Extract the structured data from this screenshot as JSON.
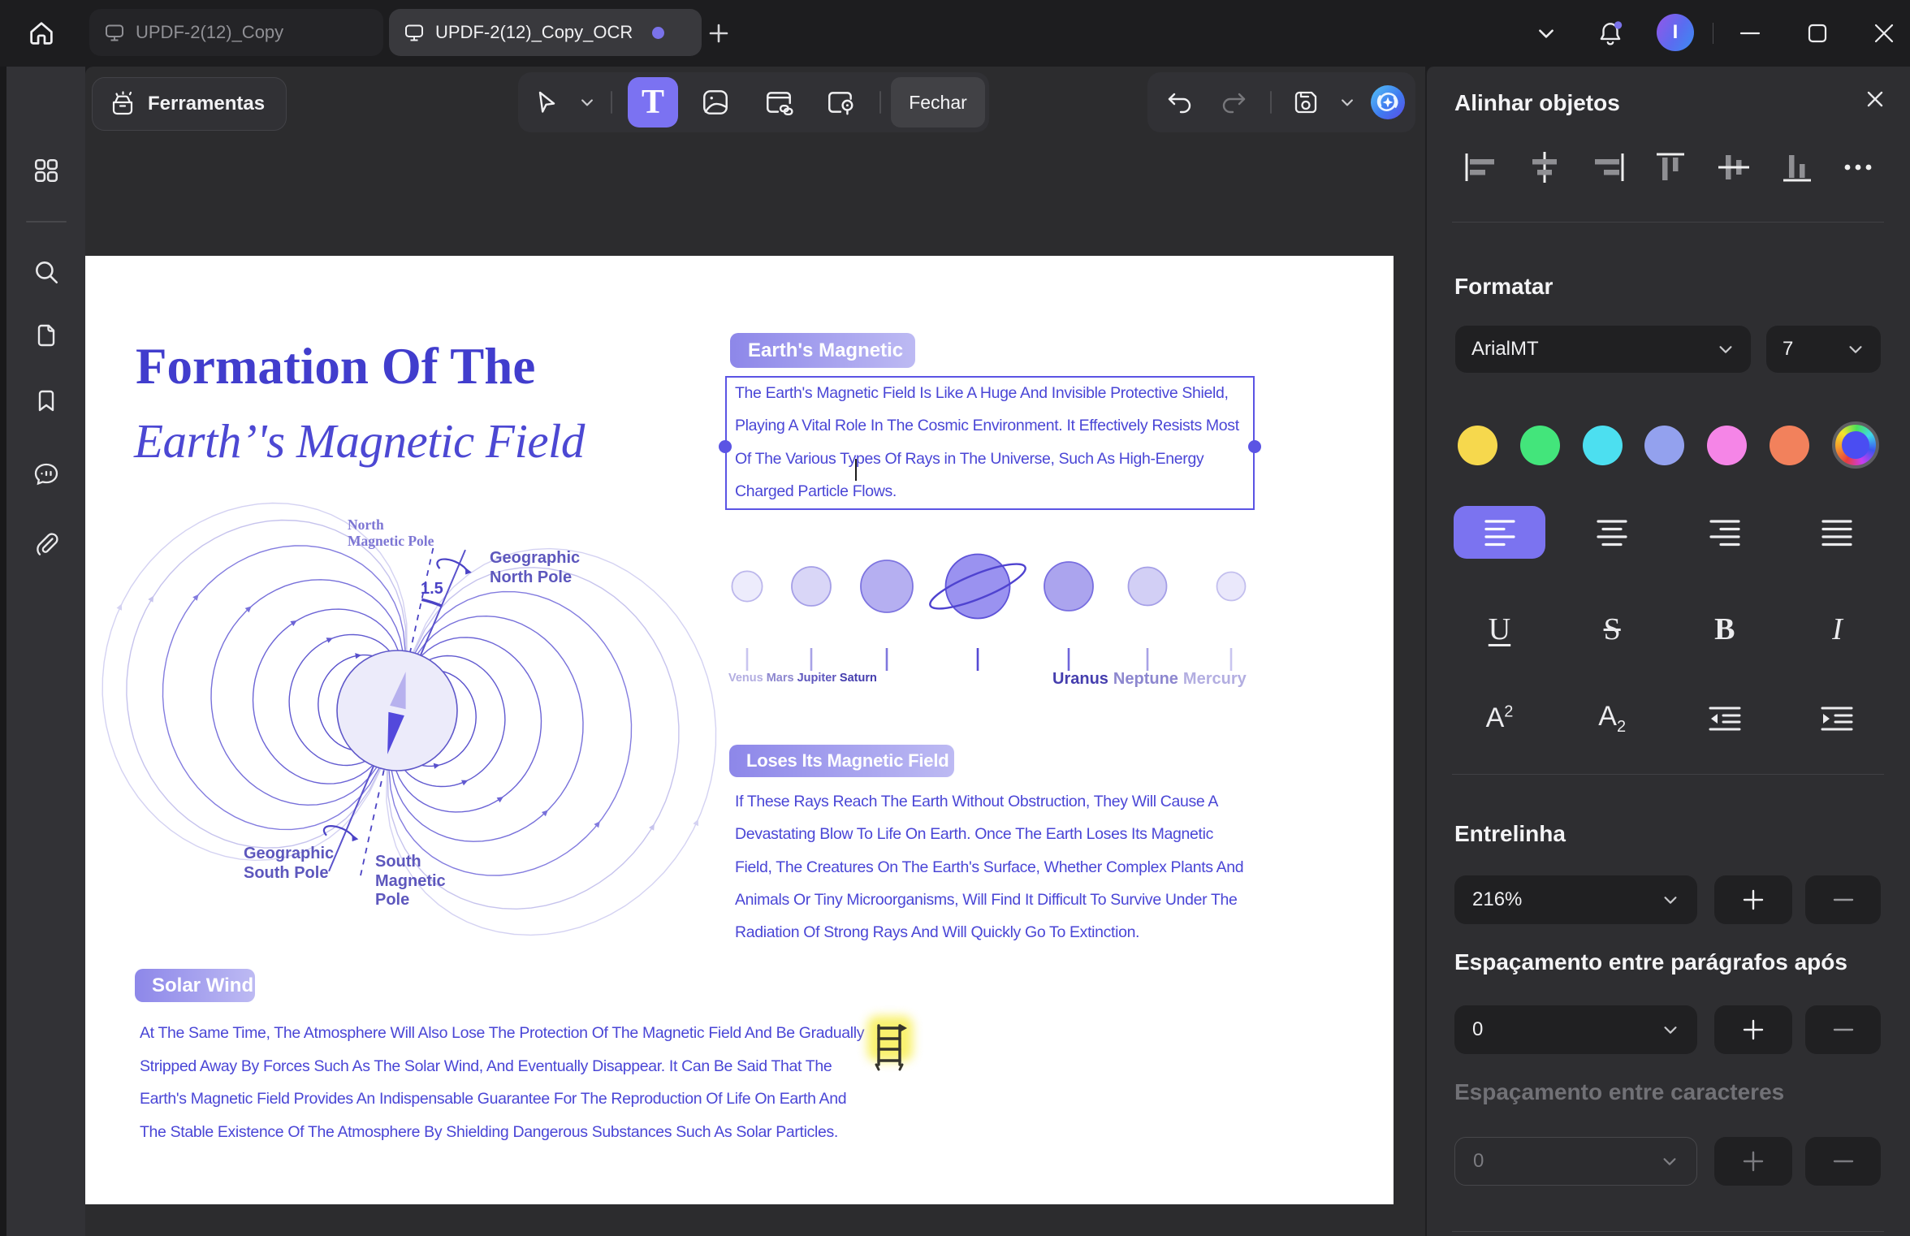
{
  "window": {
    "tabs": [
      {
        "label": "UPDF-2(12)_Copy",
        "active": false
      },
      {
        "label": "UPDF-2(12)_Copy_OCR",
        "active": true
      }
    ],
    "avatar_initial": "I"
  },
  "toolbar": {
    "tools_label": "Ferramentas",
    "close_label": "Fechar",
    "text_tool_glyph": "T"
  },
  "panel": {
    "title": "Alinhar objetos",
    "format_heading": "Formatar",
    "font_name": "ArialMT",
    "font_size": "7",
    "line_spacing_heading": "Entrelinha",
    "line_spacing_value": "216%",
    "para_spacing_heading": "Espaçamento entre parágrafos após",
    "para_spacing_value": "0",
    "char_spacing_heading": "Espaçamento entre caracteres",
    "char_spacing_value": "0",
    "style_glyphs": {
      "underline": "U",
      "strikethrough": "S",
      "bold": "B",
      "italic": "I"
    },
    "superscript_label": "A2",
    "subscript_label": "A2",
    "accent_color": "#7b73f0",
    "swatches": [
      "#f6d84d",
      "#43e57b",
      "#4cdff0",
      "#93a1ee",
      "#f585e7",
      "#f2815c"
    ]
  },
  "document": {
    "title_line1": "Formation Of The",
    "title_line2": "Earth’'s Magnetic Field",
    "chip1": "Earth's Magnetic",
    "textbox_lines": [
      "The Earth's Magnetic Field Is Like A Huge And Invisible Protective Shield,",
      "Playing A Vital Role In The Cosmic Environment. It Effectively Resists Most",
      "Of The Various Types Of Rays in The Universe, Such As High-Energy",
      "Charged Particle Flows."
    ],
    "chip2": "Loses Its Magnetic Field",
    "para2_lines": [
      "If These Rays Reach The Earth Without Obstruction, They Will Cause A",
      "Devastating Blow To Life On Earth. Once The Earth Loses Its Magnetic",
      "Field, The Creatures On The Earth's Surface, Whether Complex Plants And",
      "Animals Or Tiny Microorganisms, Will Find It Difficult To Survive Under The",
      "Radiation Of Strong Rays And Will Quickly Go To Extinction."
    ],
    "chip3": "Solar Wind",
    "para3_lines": [
      "At The Same Time, The Atmosphere Will Also Lose The Protection Of The Magnetic Field And Be Gradually",
      "Stripped Away By Forces Such As The Solar Wind, And Eventually Disappear. It Can Be Said That The",
      "Earth's Magnetic Field Provides An Indispensable Guarantee For The Reproduction Of Life On Earth And",
      "The Stable Existence Of The Atmosphere By Shielding Dangerous Substances Such As Solar Particles."
    ],
    "diagram": {
      "north_magnetic": "North\nMagnetic Pole",
      "geo_north": "Geographic\nNorth Pole",
      "angle": "1.5",
      "geo_south": "Geographic\nSouth Pole",
      "south_magnetic": "South\nMagnetic\nPole"
    },
    "planet_words1": [
      "Venus",
      "Mars",
      "Jupiter",
      "Saturn"
    ],
    "planet_words2": [
      "Uranus",
      "Neptune",
      "Mercury"
    ]
  }
}
